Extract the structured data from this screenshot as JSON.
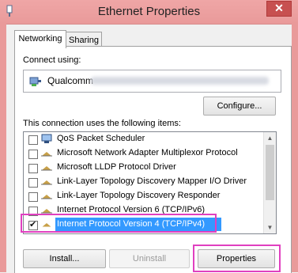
{
  "window": {
    "title": "Ethernet Properties",
    "close_glyph": "✕"
  },
  "tabs": [
    {
      "label": "Networking",
      "active": true
    },
    {
      "label": "Sharing",
      "active": false
    }
  ],
  "connect_using_label": "Connect using:",
  "adapter": {
    "name": "Qualcomm"
  },
  "configure_label": "Configure...",
  "items_label": "This connection uses the following items:",
  "items": [
    {
      "label": "QoS Packet Scheduler",
      "checked": false,
      "icon": "network-service-icon"
    },
    {
      "label": "Microsoft Network Adapter Multiplexor Protocol",
      "checked": false,
      "icon": "protocol-icon"
    },
    {
      "label": "Microsoft LLDP Protocol Driver",
      "checked": false,
      "icon": "protocol-icon"
    },
    {
      "label": "Link-Layer Topology Discovery Mapper I/O Driver",
      "checked": false,
      "icon": "protocol-icon"
    },
    {
      "label": "Link-Layer Topology Discovery Responder",
      "checked": false,
      "icon": "protocol-icon"
    },
    {
      "label": "Internet Protocol Version 6 (TCP/IPv6)",
      "checked": false,
      "icon": "protocol-icon"
    },
    {
      "label": "Internet Protocol Version 4 (TCP/IPv4)",
      "checked": true,
      "icon": "protocol-icon",
      "selected": true
    }
  ],
  "buttons": {
    "install": "Install...",
    "uninstall": "Uninstall",
    "properties": "Properties"
  },
  "colors": {
    "titlebar": "#e99a9a",
    "highlight_box": "#e040c0",
    "selection": "#3399ff"
  }
}
